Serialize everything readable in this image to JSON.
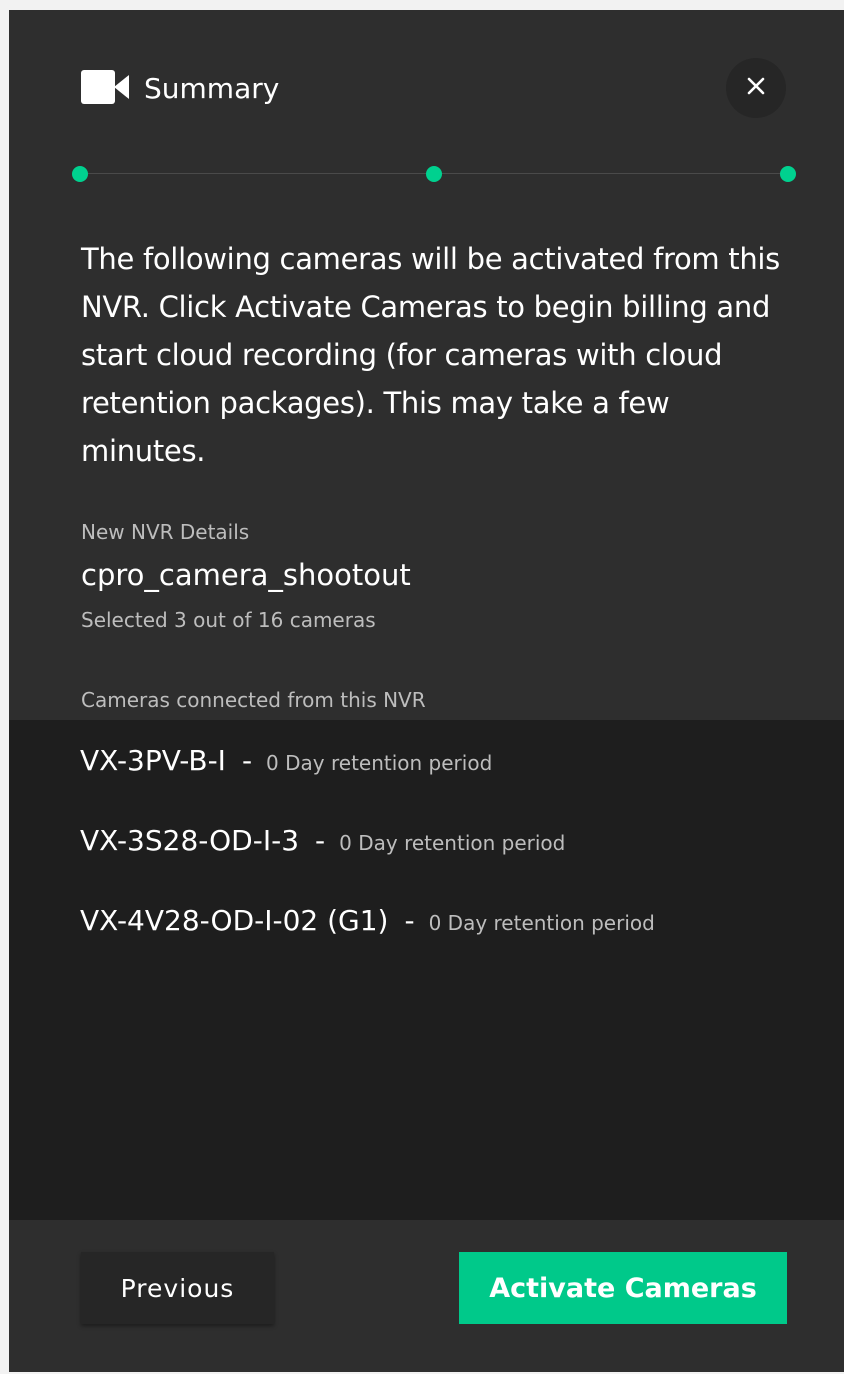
{
  "dialog": {
    "title": "Summary",
    "icon": "video-camera-icon",
    "close_icon": "close-icon"
  },
  "stepper": {
    "steps": 3,
    "current": 3,
    "accent": "#00d18f"
  },
  "intro_text": "The following cameras will be activated from this NVR. Click Activate Cameras to begin billing and start cloud recording (for cameras with cloud retention packages). This may take a few minutes.",
  "nvr": {
    "section_label": "New NVR Details",
    "name": "cpro_camera_shootout",
    "selection_text": "Selected 3 out of 16 cameras"
  },
  "cameras": {
    "section_label": "Cameras connected from this NVR",
    "separator": "-",
    "items": [
      {
        "name": "VX-3PV-B-I",
        "retention": "0 Day retention period"
      },
      {
        "name": "VX-3S28-OD-I-3",
        "retention": "0 Day retention period"
      },
      {
        "name": "VX-4V28-OD-I-02 (G1)",
        "retention": "0 Day retention period"
      }
    ]
  },
  "footer": {
    "previous_label": "Previous",
    "activate_label": "Activate Cameras",
    "activate_color": "#00c98a"
  }
}
